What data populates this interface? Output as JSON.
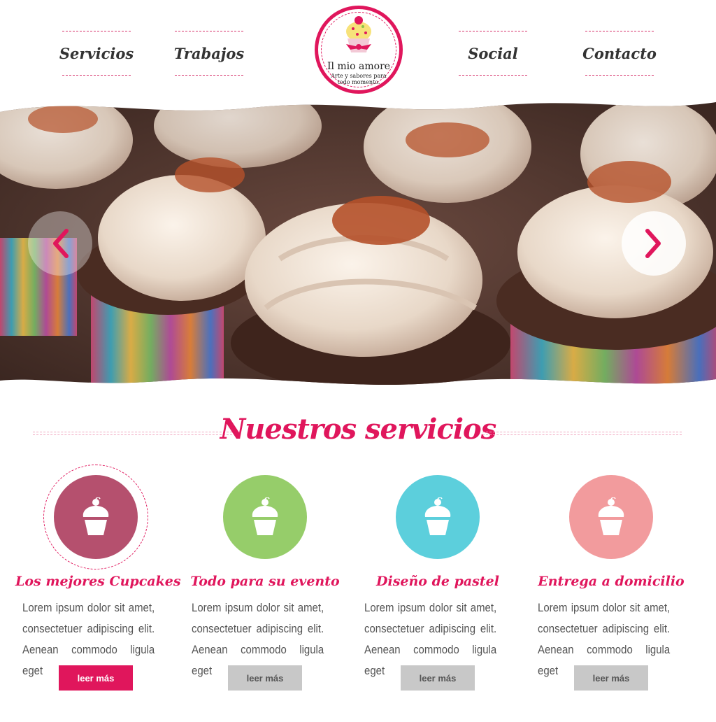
{
  "nav": {
    "items": [
      "Servicios",
      "Trabajos",
      "Social",
      "Contacto"
    ]
  },
  "logo": {
    "name": "Il mio amore",
    "tagline": "Arte y sabores para todo momento."
  },
  "hero": {
    "prev_icon": "chevron-left-icon",
    "next_icon": "chevron-right-icon"
  },
  "services": {
    "title": "Nuestros servicios",
    "items": [
      {
        "title": "Los mejores Cupcakes",
        "lines": [
          "Lorem ipsum dolor sit amet,",
          "consectetuer adipiscing elit.",
          "Aenean commodo ligula eget"
        ],
        "button": "leer más",
        "color": "#b5506e",
        "active": true,
        "icon": "cupcake-icon"
      },
      {
        "title": "Todo para su evento",
        "lines": [
          "Lorem ipsum dolor sit amet,",
          "consectetuer adipiscing elit.",
          "Aenean commodo ligula eget"
        ],
        "button": "leer más",
        "color": "#96cd6a",
        "active": false,
        "icon": "cupcake-icon"
      },
      {
        "title": "Diseño de pastel",
        "lines": [
          "Lorem ipsum dolor sit amet,",
          "consectetuer adipiscing elit.",
          "Aenean commodo ligula eget"
        ],
        "button": "leer más",
        "color": "#5ccfdc",
        "active": false,
        "icon": "cupcake-icon"
      },
      {
        "title": "Entrega a domicilio",
        "lines": [
          "Lorem ipsum dolor sit amet,",
          "consectetuer adipiscing elit.",
          "Aenean commodo ligula eget"
        ],
        "button": "leer más",
        "color": "#f29b9d",
        "active": false,
        "icon": "cupcake-icon"
      }
    ]
  },
  "colors": {
    "accent": "#e0165c",
    "button_inactive": "#c8c8c8"
  }
}
